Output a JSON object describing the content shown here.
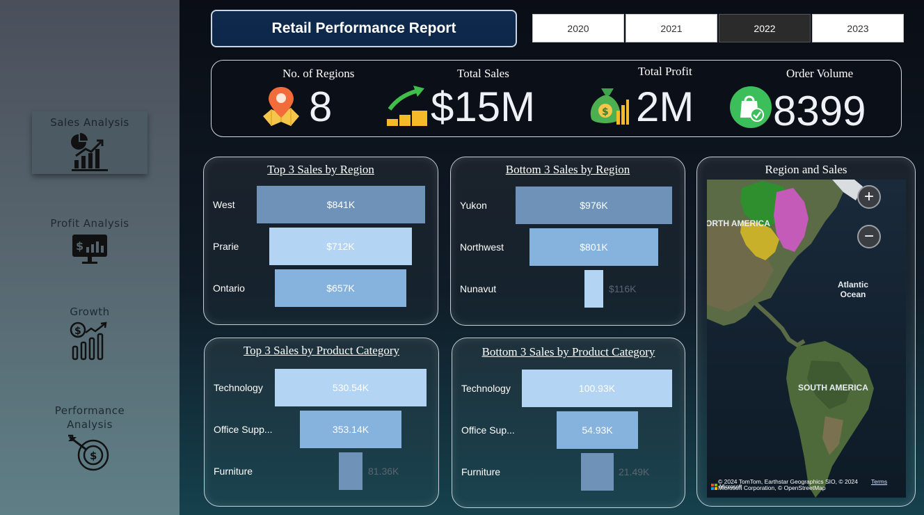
{
  "sidebar": {
    "items": [
      {
        "label": "Sales Analysis",
        "icon": "sales-chart-icon"
      },
      {
        "label": "Profit Analysis",
        "icon": "profit-monitor-icon"
      },
      {
        "label": "Growth",
        "icon": "growth-chart-icon"
      },
      {
        "label": "Performance Analysis",
        "icon": "target-dollar-icon"
      }
    ]
  },
  "header": {
    "title": "Retail Performance Report",
    "years": [
      "2020",
      "2021",
      "2022",
      "2023"
    ],
    "selected_year": "2022"
  },
  "kpis": {
    "regions": {
      "label": "No. of Regions",
      "value": "8",
      "icon": "map-pin-icon"
    },
    "sales": {
      "label": "Total Sales",
      "value": "$15M",
      "icon": "sales-growth-icon"
    },
    "profit": {
      "label": "Total Profit",
      "value": "2M",
      "icon": "money-bag-icon"
    },
    "orders": {
      "label": "Order Volume",
      "value": "8399",
      "icon": "shopping-bag-check-icon"
    }
  },
  "top_region": {
    "title": "Top 3 Sales by Region",
    "rows": [
      {
        "label": "West",
        "value": "$841K"
      },
      {
        "label": "Prarie",
        "value": "$712K"
      },
      {
        "label": "Ontario",
        "value": "$657K"
      }
    ]
  },
  "bottom_region": {
    "title": "Bottom 3 Sales by Region",
    "rows": [
      {
        "label": "Yukon",
        "value": "$976K"
      },
      {
        "label": "Northwest",
        "value": "$801K"
      },
      {
        "label": "Nunavut",
        "value": "$116K"
      }
    ]
  },
  "top_category": {
    "title": "Top 3 Sales by Product Category",
    "rows": [
      {
        "label": "Technology",
        "value": "530.54K"
      },
      {
        "label": "Office Supp...",
        "value": "353.14K"
      },
      {
        "label": "Furniture",
        "value": "81.36K"
      }
    ]
  },
  "bottom_category": {
    "title": "Bottom 3 Sales by Product Category",
    "rows": [
      {
        "label": "Technology",
        "value": "100.93K"
      },
      {
        "label": "Office Sup...",
        "value": "54.93K"
      },
      {
        "label": "Furniture",
        "value": "21.49K"
      }
    ]
  },
  "map": {
    "title": "Region and Sales",
    "zoom_in": "+",
    "zoom_out": "−",
    "labels": {
      "north_america": "ORTH AMERICA",
      "atlantic": "Atlantic Ocean",
      "south_america": "SOUTH AMERICA"
    },
    "credit": "© 2024 TomTom, Earthstar Geographics SIO, © 2024 Microsoft Corporation, © OpenStreetMap",
    "credit_link": "Terms",
    "brand": "Microsoft"
  },
  "colors": {
    "bar_dark": "#6f93b8",
    "bar_light": "#b3d4f2",
    "bar_mid": "#86b2de",
    "bar_tiny": "#a9cdef",
    "title_bg": "#0f2a4d"
  }
}
